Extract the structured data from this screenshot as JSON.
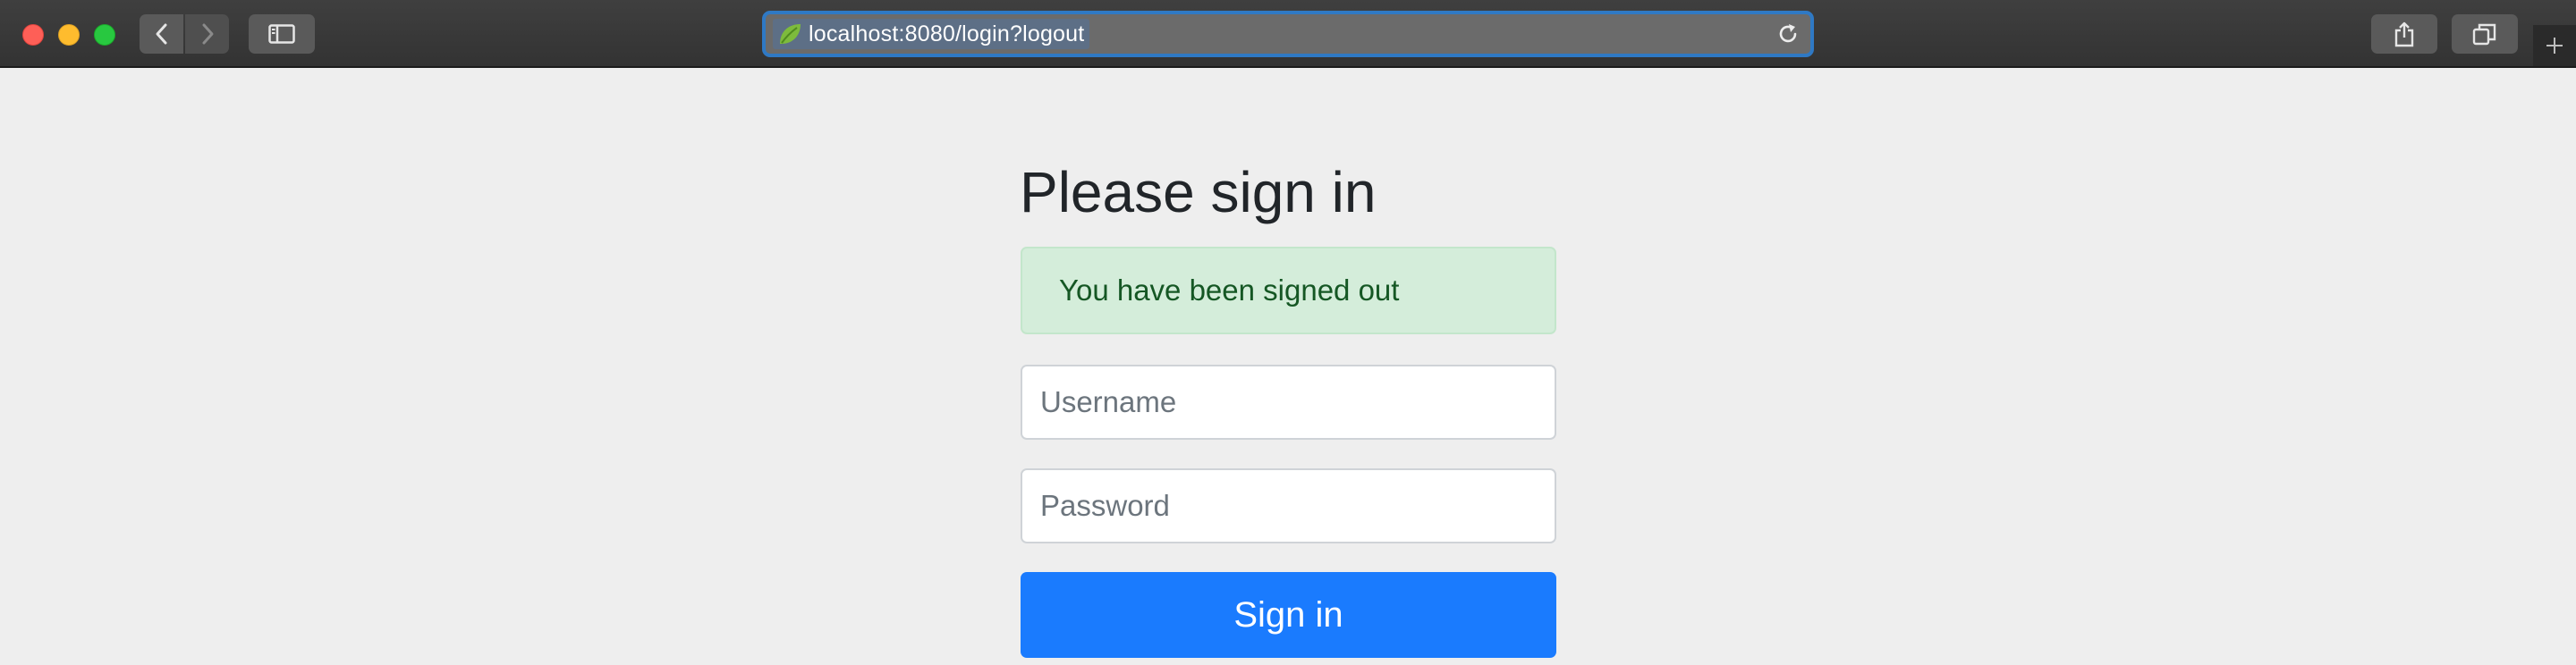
{
  "browser": {
    "url": "localhost:8080/login?logout",
    "icons": {
      "back": "chevron-left-icon",
      "forward": "chevron-right-icon",
      "sidebar": "sidebar-icon",
      "favicon": "spring-leaf-icon",
      "reload": "reload-icon",
      "share": "share-icon",
      "tabs": "tab-overview-icon",
      "new_tab": "plus-icon"
    },
    "colors": {
      "close": "#fe5f57",
      "minimize": "#febc2e",
      "zoom": "#28c840",
      "url_focus_ring": "#2f79c4"
    }
  },
  "login": {
    "heading": "Please sign in",
    "alert": "You have been signed out",
    "username_placeholder": "Username",
    "password_placeholder": "Password",
    "submit_label": "Sign in",
    "colors": {
      "alert_bg": "#d4edda",
      "alert_text": "#155724",
      "button_bg": "#1a7bfe"
    }
  }
}
